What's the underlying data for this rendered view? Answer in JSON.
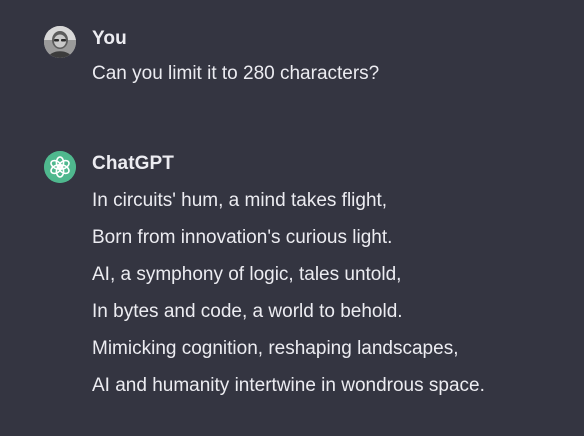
{
  "messages": {
    "user": {
      "author": "You",
      "avatar_icon": "user-avatar-photo",
      "text": "Can you limit it to 280 characters?"
    },
    "assistant": {
      "author": "ChatGPT",
      "avatar_icon": "openai-logo-icon",
      "avatar_color": "#4fb88e",
      "lines": [
        "In circuits' hum, a mind takes flight,",
        "Born from innovation's curious light.",
        "AI, a symphony of logic, tales untold,",
        "In bytes and code, a world to behold.",
        "Mimicking cognition, reshaping landscapes,",
        "AI and humanity intertwine in wondrous space."
      ]
    }
  },
  "colors": {
    "background": "#343541",
    "text": "#ececf1"
  }
}
